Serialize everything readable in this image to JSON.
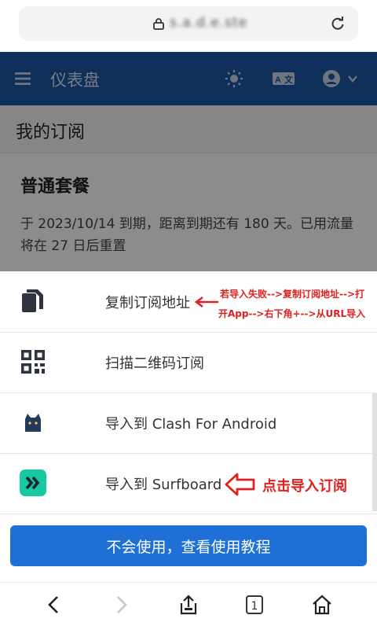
{
  "browser": {
    "url": "s.a.d.e.ste",
    "tab_count": "1"
  },
  "navbar": {
    "title": "仪表盘"
  },
  "page": {
    "title": "我的订阅",
    "plan_name": "普通套餐",
    "plan_desc": "于 2023/10/14 到期，距离到期还有 180 天。已用流量将在 27 日后重置"
  },
  "sheet": {
    "items": [
      {
        "label": "复制订阅地址",
        "icon": "copy-icon"
      },
      {
        "label": "扫描二维码订阅",
        "icon": "qrcode-icon"
      },
      {
        "label": "导入到 Clash For Android",
        "icon": "cat-icon"
      },
      {
        "label": "导入到 Surfboard",
        "icon": "surfboard-icon"
      }
    ],
    "help_button": "不会使用，查看使用教程"
  },
  "annotations": {
    "line1": "若导入失败-->复制订阅地址-->打",
    "line2": "开App-->右下角+-->从URL导入",
    "surfboard": "点击导入订阅",
    "color": "#e02020"
  },
  "colors": {
    "navbar": "#1b56a4",
    "primary_button": "#1e6fd6",
    "surfboard_icon": "#17c8a0"
  }
}
